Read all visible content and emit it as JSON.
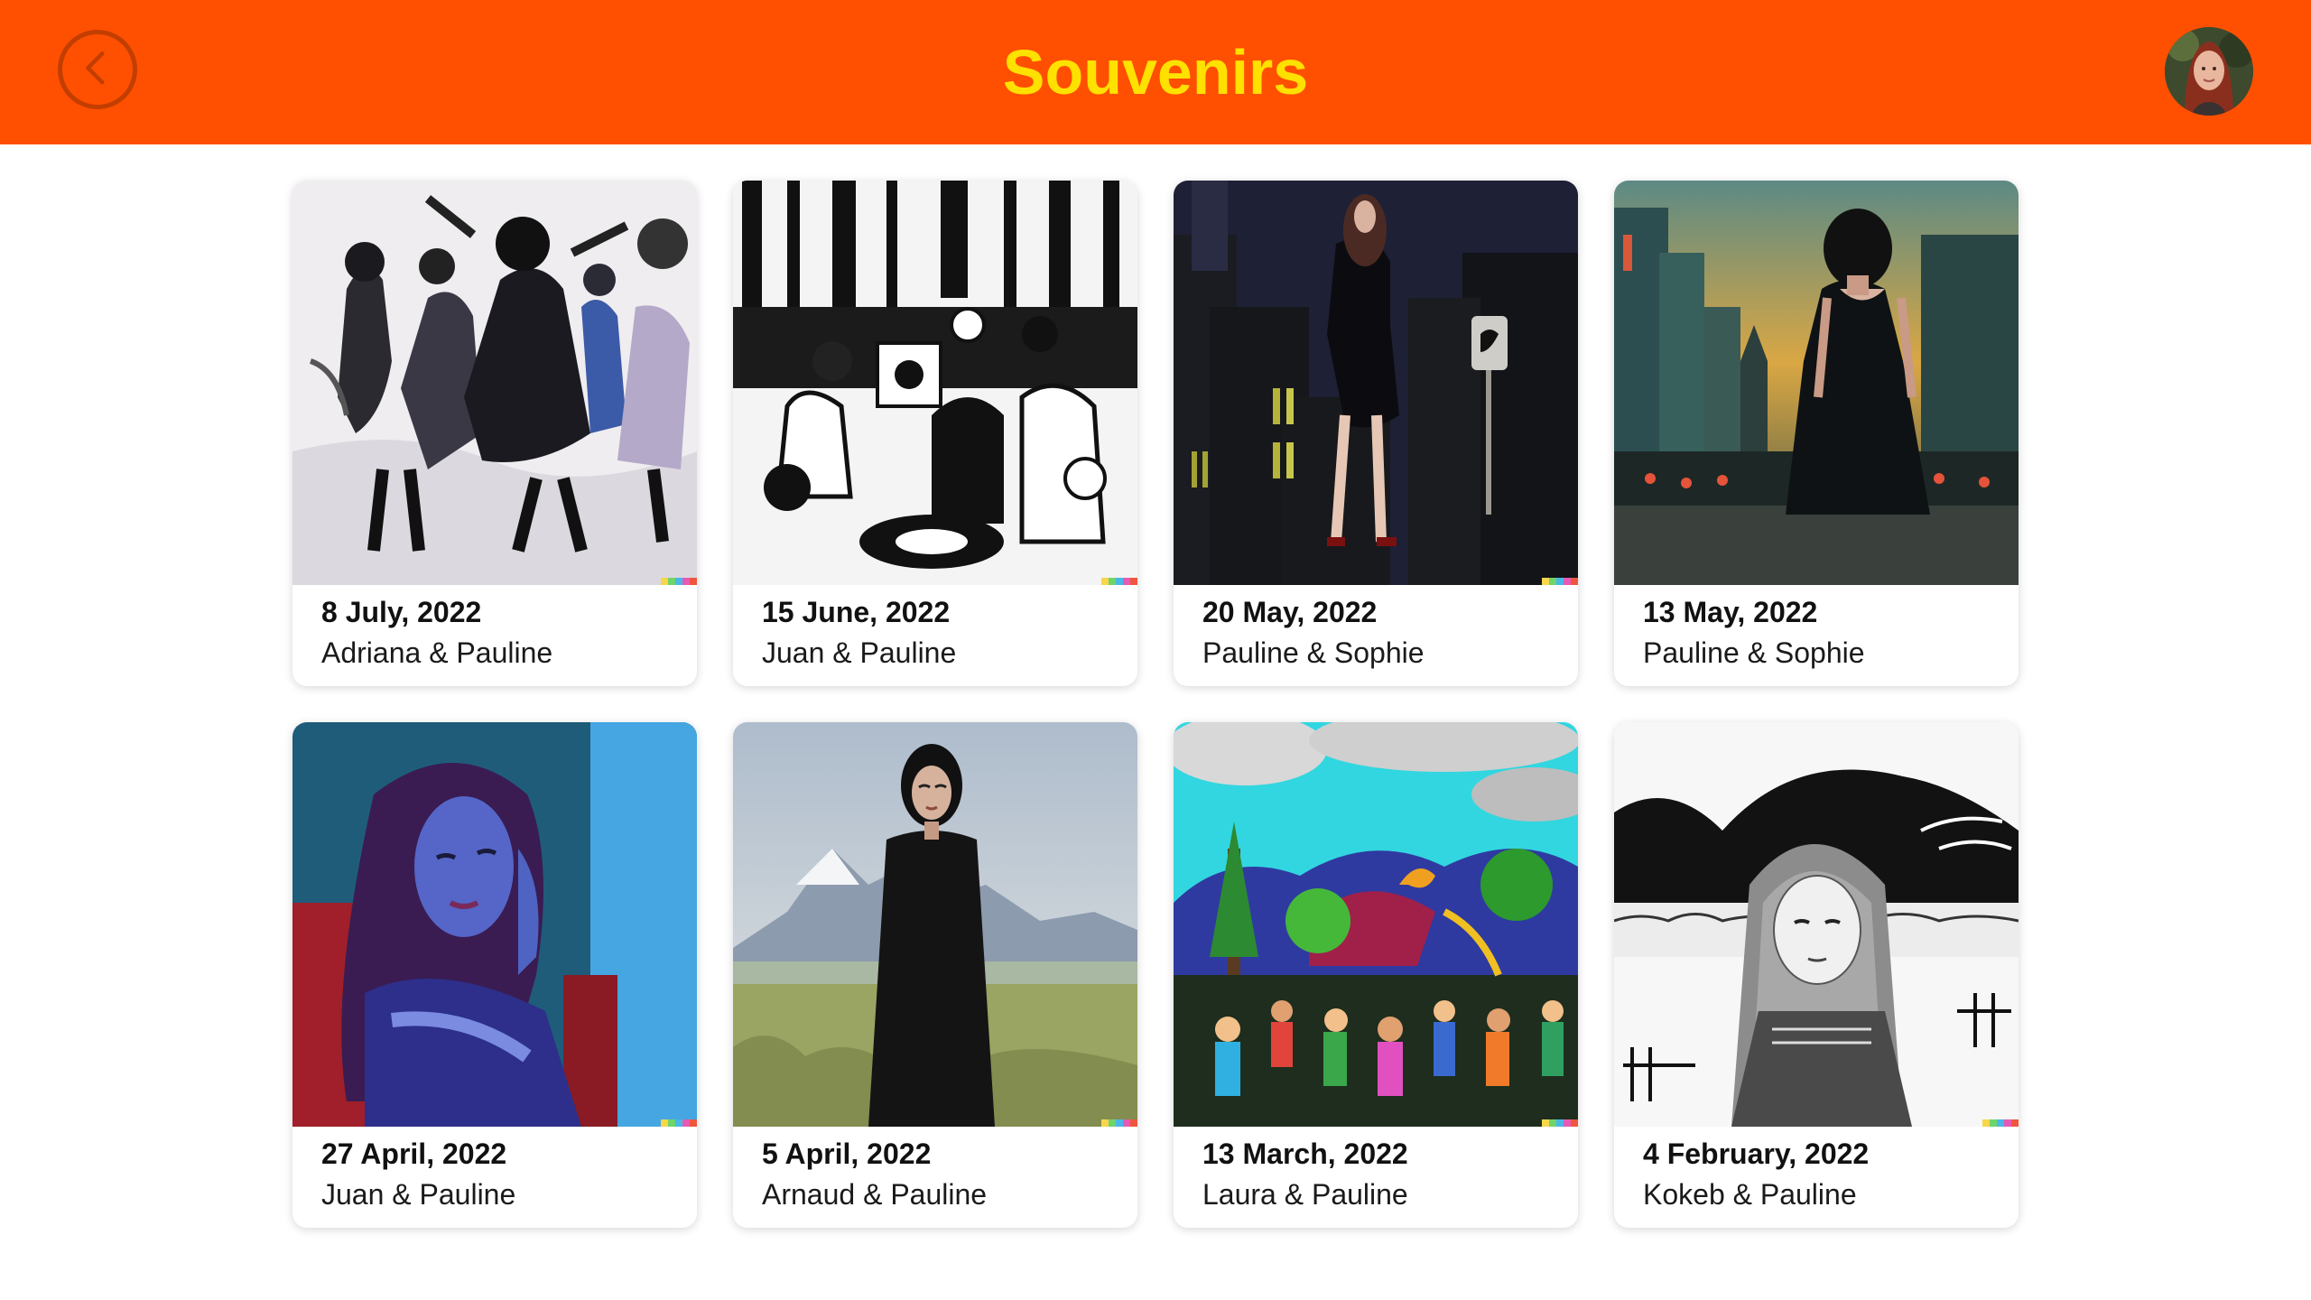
{
  "header": {
    "title": "Souvenirs",
    "back_icon": "chevron-left-icon",
    "avatar_icon": "user-avatar",
    "background_color": "#FF4F00",
    "title_color": "#FFE100"
  },
  "souvenirs": [
    {
      "date": "8 July, 2022",
      "people": "Adriana & Pauline",
      "art": "sketch of women dancing"
    },
    {
      "date": "15 June, 2022",
      "people": "Juan & Pauline",
      "art": "ink drawing of party in forest"
    },
    {
      "date": "20 May, 2022",
      "people": "Pauline & Sophie",
      "art": "woman in black dress in night city"
    },
    {
      "date": "13 May, 2022",
      "people": "Pauline & Sophie",
      "art": "painting of woman facing city at dusk"
    },
    {
      "date": "27 April, 2022",
      "people": "Juan & Pauline",
      "art": "blue portrait of pensive woman"
    },
    {
      "date": "5 April, 2022",
      "people": "Arnaud & Pauline",
      "art": "woman in black standing before mountains"
    },
    {
      "date": "13 March, 2022",
      "people": "Laura & Pauline",
      "art": "colorful festival crowd painting"
    },
    {
      "date": "4 February, 2022",
      "people": "Kokeb & Pauline",
      "art": "black and white drawing of girl with long hair"
    }
  ]
}
